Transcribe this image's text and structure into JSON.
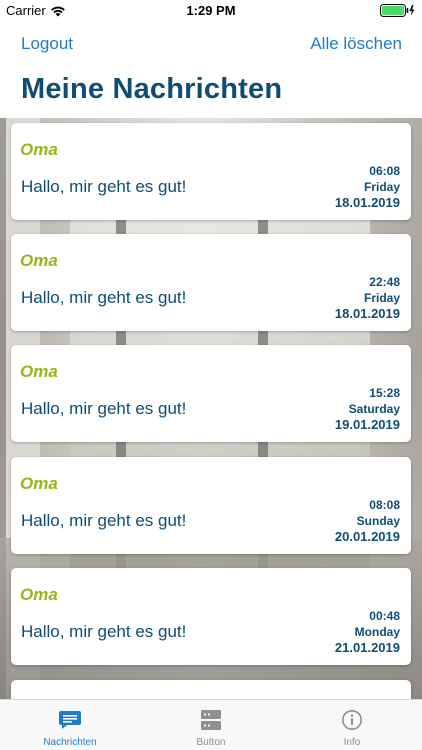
{
  "status_bar": {
    "carrier": "Carrier",
    "time": "1:29 PM"
  },
  "nav": {
    "logout_label": "Logout",
    "clear_all_label": "Alle löschen",
    "title": "Meine Nachrichten"
  },
  "messages": [
    {
      "sender": "Oma",
      "text": "Hallo, mir geht es gut!",
      "time": "06:08",
      "weekday": "Friday",
      "date": "18.01.2019"
    },
    {
      "sender": "Oma",
      "text": "Hallo, mir geht es gut!",
      "time": "22:48",
      "weekday": "Friday",
      "date": "18.01.2019"
    },
    {
      "sender": "Oma",
      "text": "Hallo, mir geht es gut!",
      "time": "15:28",
      "weekday": "Saturday",
      "date": "19.01.2019"
    },
    {
      "sender": "Oma",
      "text": "Hallo, mir geht es gut!",
      "time": "08:08",
      "weekday": "Sunday",
      "date": "20.01.2019"
    },
    {
      "sender": "Oma",
      "text": "Hallo, mir geht es gut!",
      "time": "00:48",
      "weekday": "Monday",
      "date": "21.01.2019"
    }
  ],
  "tabs": [
    {
      "label": "Nachrichten",
      "icon": "chat-bubble-icon",
      "active": true
    },
    {
      "label": "Button",
      "icon": "server-icon",
      "active": false
    },
    {
      "label": "Info",
      "icon": "info-icon",
      "active": false
    }
  ],
  "colors": {
    "accent": "#1f7ccc",
    "title": "#0f4d73",
    "sender": "#94b51c",
    "battery": "#4cd964"
  }
}
